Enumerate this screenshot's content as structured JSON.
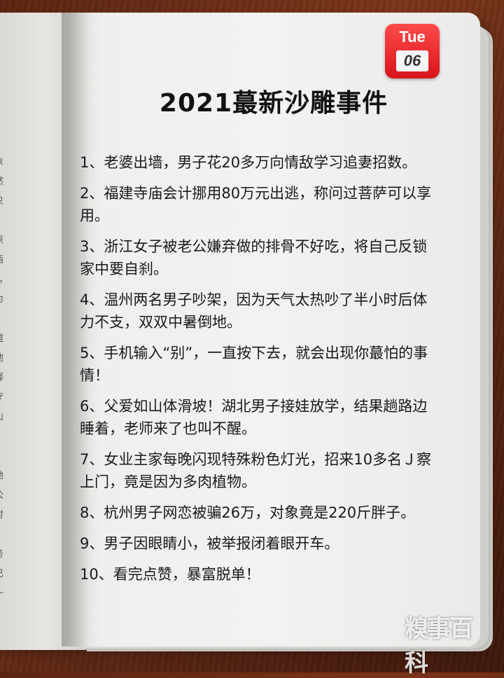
{
  "badge": {
    "day": "Tue",
    "date": "06"
  },
  "title": "2021蕞新沙雕事件",
  "items": [
    "1、老婆出墙，男子花20多万向情敌学习追妻招数。",
    "2、福建寺庙会计挪用80万元出逃，称问过菩萨可以享用。",
    "3、浙江女子被老公嫌弃做的排骨不好吃，将自己反锁家中要自刹。",
    "4、温州两名男子吵架，因为天气太热吵了半小时后体力不支，双双中暑倒地。",
    "5、手机输入“别”，一直按下去，就会出现你蕞怕的事情！",
    "6、父爱如山体滑坡！湖北男子接娃放学，结果趟路边睡着，老师来了也叫不醒。",
    "7、女业主家每晚闪现特殊粉色灯光，招来10多名Ｊ察上门，竟是因为多肉植物。",
    "8、杭州男子网恋被骗26万，对象竟是220斤胖子。",
    "9、男子因眼睛小，被举报闭着眼开车。",
    "10、看完点赞，暴富脱单！"
  ],
  "left_page_chars": [
    "象",
    "然",
    "只",
    "",
    "原",
    "西",
    "：，",
    "为",
    "",
    "遨",
    "地",
    "释",
    "疗",
    "山",
    "",
    "，",
    "她",
    "公",
    "时",
    "",
    "务",
    "已",
    "一"
  ],
  "watermark": "糗事百科"
}
